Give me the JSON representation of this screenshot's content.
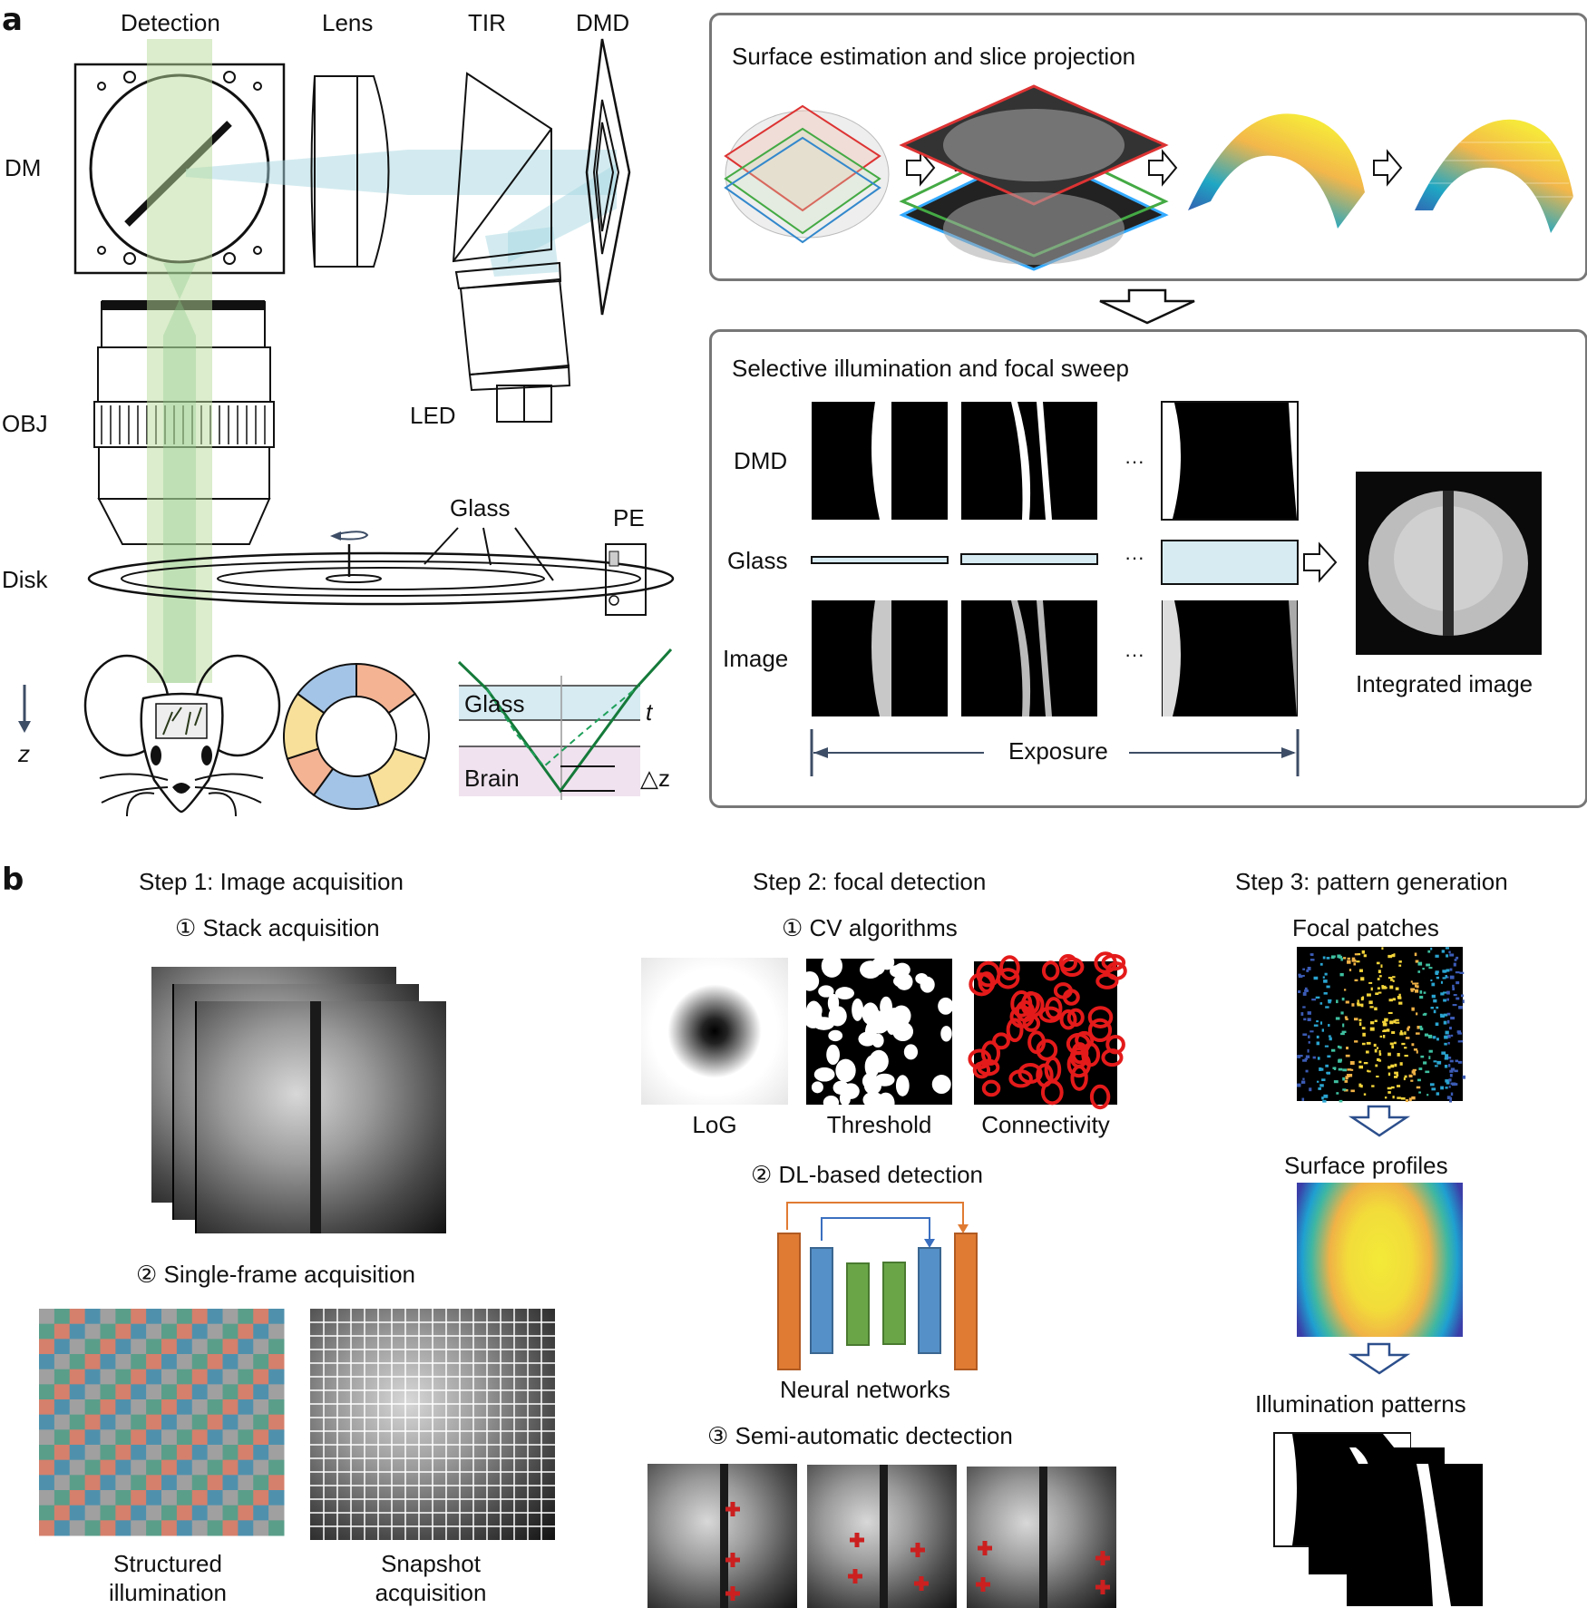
{
  "panel_a": {
    "letter": "a",
    "hardware_labels": {
      "detection": "Detection",
      "lens": "Lens",
      "tir": "TIR",
      "dmd": "DMD",
      "dm": "DM",
      "obj": "OBJ",
      "led": "LED",
      "glass": "Glass",
      "pe": "PE",
      "disk": "Disk",
      "z": "z"
    },
    "inset_labels": {
      "glass": "Glass",
      "brain": "Brain",
      "t": "t",
      "delta_z": "△z"
    },
    "disk_segment_colors": [
      "#a3c4e6",
      "#f4b393",
      "#f8e09a",
      "#a3c4e6",
      "#f4b393",
      "#f8e09a"
    ],
    "surface_box": {
      "title": "Surface estimation and slice projection",
      "ellipsis": "⋮"
    },
    "sweep_box": {
      "title": "Selective illumination and focal sweep",
      "row_labels": [
        "DMD",
        "Glass",
        "Image"
      ],
      "ellipsis": "···",
      "exposure_label": "Exposure",
      "integrated_label": "Integrated image"
    }
  },
  "panel_b": {
    "letter": "b",
    "step1": {
      "title": "Step 1: Image acquisition",
      "sub1": "① Stack acquisition",
      "sub2": "② Single-frame acquisition",
      "caption_left_line1": "Structured",
      "caption_left_line2": "illumination",
      "caption_right_line1": "Snapshot",
      "caption_right_line2": "acquisition",
      "checker_colors": [
        "#a0a0a0",
        "#5a9e8a",
        "#d4806c",
        "#4f91ad"
      ]
    },
    "step2": {
      "title": "Step 2: focal detection",
      "sub1": "① CV algorithms",
      "cv_captions": [
        "LoG",
        "Threshold",
        "Connectivity"
      ],
      "sub2": "② DL-based detection",
      "nn_caption": "Neural networks",
      "nn_colors": {
        "outer": "#e07b33",
        "mid": "#5590c8",
        "inner": "#6aa648"
      },
      "sub3": "③ Semi-automatic dectection"
    },
    "step3": {
      "title": "Step 3: pattern generation",
      "focal_label": "Focal patches",
      "surface_label": "Surface profiles",
      "illum_label": "Illumination patterns"
    }
  }
}
